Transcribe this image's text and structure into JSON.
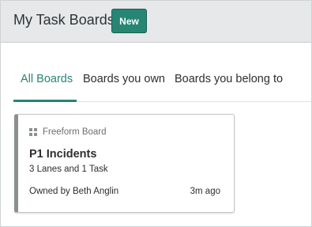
{
  "header": {
    "title": "My Task Boards",
    "new_button_label": "New"
  },
  "tabs": [
    {
      "label": "All Boards",
      "active": true
    },
    {
      "label": "Boards you own",
      "active": false
    },
    {
      "label": "Boards you belong to",
      "active": false
    }
  ],
  "boards": [
    {
      "type": "Freeform Board",
      "type_icon": "grid-icon",
      "title": "P1 Incidents",
      "lanes_count": "3",
      "lanes_label": "Lanes and",
      "tasks_count": "1",
      "tasks_label": "Task",
      "owner": "Owned by Beth Anglin",
      "updated": "3m ago"
    }
  ],
  "colors": {
    "accent": "#278574",
    "header_bg": "#e6e8ea",
    "card_stripe": "#8c8f91"
  }
}
